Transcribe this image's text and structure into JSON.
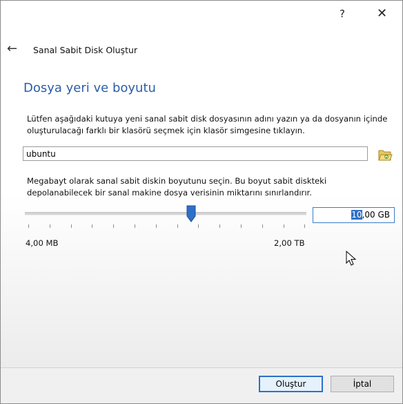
{
  "titlebar": {
    "help": "?",
    "close": "✕"
  },
  "wizard": {
    "title": "Sanal Sabit Disk Oluştur"
  },
  "page": {
    "heading": "Dosya yeri ve boyutu",
    "location_desc": "Lütfen aşağıdaki kutuya yeni sanal sabit disk dosyasının adını yazın ya da dosyanın içinde oluşturulacağı farklı bir klasörü seçmek için klasör simgesine tıklayın.",
    "file_name": "ubuntu",
    "size_desc": "Megabayt olarak sanal sabit diskin boyutunu seçin. Bu boyut sabit diskteki depolanabilecek bir sanal makine dosya verisinin miktarını sınırlandırır.",
    "slider_min": "4,00 MB",
    "slider_max": "2,00 TB",
    "size_selected": "10",
    "size_rest": ",00 GB"
  },
  "buttons": {
    "create": "Oluştur",
    "cancel": "İptal"
  },
  "colors": {
    "heading": "#2b5da8",
    "accent": "#2e6fc7"
  },
  "icons": {
    "back": "arrow-left",
    "folder": "folder-open",
    "slider": "slider-handle",
    "cursor": "mouse-pointer"
  }
}
